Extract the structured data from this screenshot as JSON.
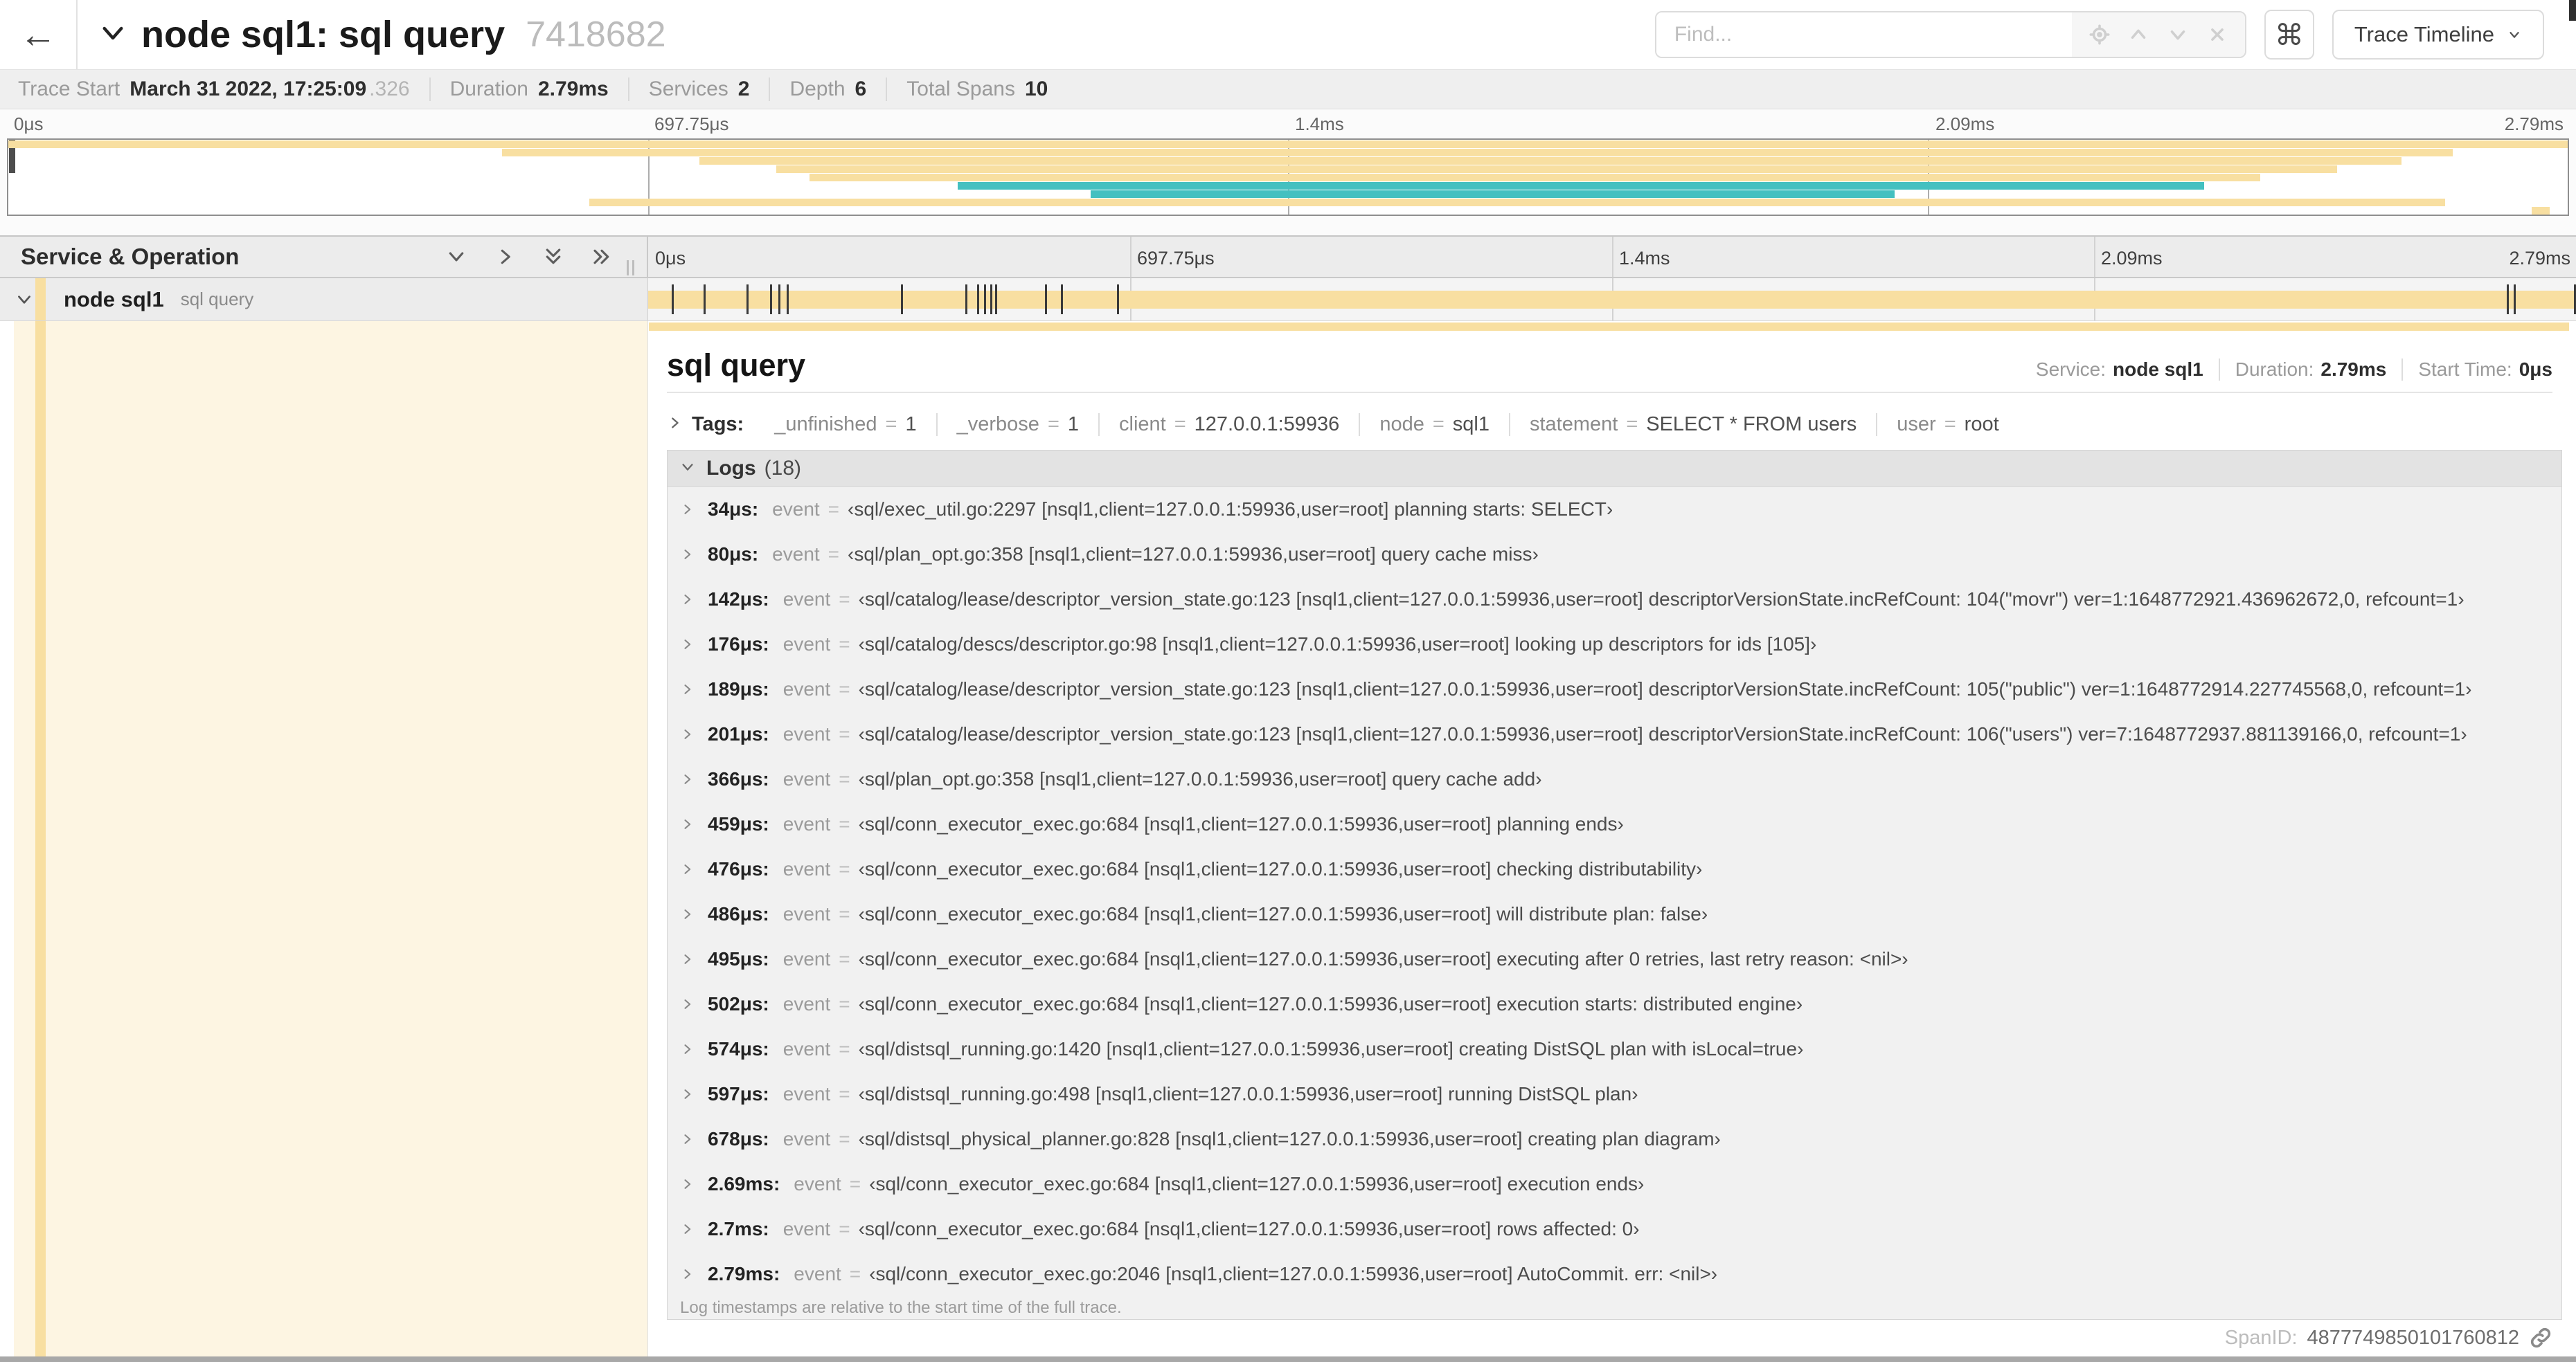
{
  "header": {
    "back_icon": "←",
    "title": "node sql1: sql query",
    "trace_id_short": "7418682",
    "find_placeholder": "Find...",
    "keyboard_shortcut_icon": "⌘",
    "view_selector_label": "Trace Timeline"
  },
  "summary": {
    "items": [
      {
        "label": "Trace Start",
        "value": "March 31 2022, 17:25:09",
        "suffix": ".326"
      },
      {
        "label": "Duration",
        "value": "2.79ms"
      },
      {
        "label": "Services",
        "value": "2"
      },
      {
        "label": "Depth",
        "value": "6"
      },
      {
        "label": "Total Spans",
        "value": "10"
      }
    ]
  },
  "colors": {
    "span_tan": "#F8DFA1",
    "span_teal": "#44C0C0",
    "expanded_row_bg": "#FDF5E2"
  },
  "minimap": {
    "axis_labels": [
      "0μs",
      "697.75μs",
      "1.4ms",
      "2.09ms",
      "2.79ms"
    ],
    "grid_fractions": [
      0.25,
      0.5,
      0.75
    ],
    "spans": [
      {
        "start": 0.0,
        "end": 1.0,
        "color": "#F8DFA1"
      },
      {
        "start": 0.193,
        "end": 0.955,
        "color": "#F8DFA1"
      },
      {
        "start": 0.27,
        "end": 0.935,
        "color": "#F8DFA1"
      },
      {
        "start": 0.3,
        "end": 0.91,
        "color": "#F8DFA1"
      },
      {
        "start": 0.313,
        "end": 0.88,
        "color": "#F8DFA1"
      },
      {
        "start": 0.371,
        "end": 0.858,
        "color": "#44C0C0"
      },
      {
        "start": 0.423,
        "end": 0.737,
        "color": "#44C0C0"
      },
      {
        "start": 0.227,
        "end": 0.952,
        "color": "#F8DFA1"
      },
      {
        "start": 0.986,
        "end": 0.993,
        "color": "#F8DFA1"
      }
    ]
  },
  "timeline": {
    "column_header": "Service & Operation",
    "axis_labels": [
      "0μs",
      "697.75μs",
      "1.4ms",
      "2.09ms",
      "2.79ms"
    ],
    "grid_fractions": [
      0.25,
      0.5,
      0.75
    ],
    "row": {
      "service": "node sql1",
      "operation": "sql query",
      "bar_start": 0.0,
      "bar_end": 1.0,
      "tick_fractions": [
        0.0122,
        0.0287,
        0.0509,
        0.0631,
        0.0677,
        0.072,
        0.1312,
        0.1645,
        0.1706,
        0.1742,
        0.1774,
        0.18,
        0.2057,
        0.214,
        0.243,
        0.9642,
        0.9677,
        0.999
      ]
    }
  },
  "detail": {
    "operation_name": "sql query",
    "meta": [
      {
        "label": "Service:",
        "value": "node sql1"
      },
      {
        "label": "Duration:",
        "value": "2.79ms"
      },
      {
        "label": "Start Time:",
        "value": "0μs"
      }
    ],
    "tags": {
      "label": "Tags:",
      "items": [
        {
          "key": "_unfinished",
          "value": "1"
        },
        {
          "key": "_verbose",
          "value": "1"
        },
        {
          "key": "client",
          "value": "127.0.0.1:59936"
        },
        {
          "key": "node",
          "value": "sql1"
        },
        {
          "key": "statement",
          "value": "SELECT * FROM users"
        },
        {
          "key": "user",
          "value": "root"
        }
      ]
    },
    "logs": {
      "label": "Logs",
      "count": "(18)",
      "entries": [
        {
          "time": "34μs:",
          "key": "event",
          "value": "‹sql/exec_util.go:2297 [nsql1,client=127.0.0.1:59936,user=root] planning starts: SELECT›"
        },
        {
          "time": "80μs:",
          "key": "event",
          "value": "‹sql/plan_opt.go:358 [nsql1,client=127.0.0.1:59936,user=root] query cache miss›"
        },
        {
          "time": "142μs:",
          "key": "event",
          "value": "‹sql/catalog/lease/descriptor_version_state.go:123 [nsql1,client=127.0.0.1:59936,user=root] descriptorVersionState.incRefCount: 104(\"movr\") ver=1:1648772921.436962672,0, refcount=1›"
        },
        {
          "time": "176μs:",
          "key": "event",
          "value": "‹sql/catalog/descs/descriptor.go:98 [nsql1,client=127.0.0.1:59936,user=root] looking up descriptors for ids [105]›"
        },
        {
          "time": "189μs:",
          "key": "event",
          "value": "‹sql/catalog/lease/descriptor_version_state.go:123 [nsql1,client=127.0.0.1:59936,user=root] descriptorVersionState.incRefCount: 105(\"public\") ver=1:1648772914.227745568,0, refcount=1›"
        },
        {
          "time": "201μs:",
          "key": "event",
          "value": "‹sql/catalog/lease/descriptor_version_state.go:123 [nsql1,client=127.0.0.1:59936,user=root] descriptorVersionState.incRefCount: 106(\"users\") ver=7:1648772937.881139166,0, refcount=1›"
        },
        {
          "time": "366μs:",
          "key": "event",
          "value": "‹sql/plan_opt.go:358 [nsql1,client=127.0.0.1:59936,user=root] query cache add›"
        },
        {
          "time": "459μs:",
          "key": "event",
          "value": "‹sql/conn_executor_exec.go:684 [nsql1,client=127.0.0.1:59936,user=root] planning ends›"
        },
        {
          "time": "476μs:",
          "key": "event",
          "value": "‹sql/conn_executor_exec.go:684 [nsql1,client=127.0.0.1:59936,user=root] checking distributability›"
        },
        {
          "time": "486μs:",
          "key": "event",
          "value": "‹sql/conn_executor_exec.go:684 [nsql1,client=127.0.0.1:59936,user=root] will distribute plan: false›"
        },
        {
          "time": "495μs:",
          "key": "event",
          "value": "‹sql/conn_executor_exec.go:684 [nsql1,client=127.0.0.1:59936,user=root] executing after 0 retries, last retry reason: <nil>›"
        },
        {
          "time": "502μs:",
          "key": "event",
          "value": "‹sql/conn_executor_exec.go:684 [nsql1,client=127.0.0.1:59936,user=root] execution starts: distributed engine›"
        },
        {
          "time": "574μs:",
          "key": "event",
          "value": "‹sql/distsql_running.go:1420 [nsql1,client=127.0.0.1:59936,user=root] creating DistSQL plan with isLocal=true›"
        },
        {
          "time": "597μs:",
          "key": "event",
          "value": "‹sql/distsql_running.go:498 [nsql1,client=127.0.0.1:59936,user=root] running DistSQL plan›"
        },
        {
          "time": "678μs:",
          "key": "event",
          "value": "‹sql/distsql_physical_planner.go:828 [nsql1,client=127.0.0.1:59936,user=root] creating plan diagram›"
        },
        {
          "time": "2.69ms:",
          "key": "event",
          "value": "‹sql/conn_executor_exec.go:684 [nsql1,client=127.0.0.1:59936,user=root] execution ends›"
        },
        {
          "time": "2.7ms:",
          "key": "event",
          "value": "‹sql/conn_executor_exec.go:684 [nsql1,client=127.0.0.1:59936,user=root] rows affected: 0›"
        },
        {
          "time": "2.79ms:",
          "key": "event",
          "value": "‹sql/conn_executor_exec.go:2046 [nsql1,client=127.0.0.1:59936,user=root] AutoCommit. err: <nil>›"
        }
      ],
      "footnote": "Log timestamps are relative to the start time of the full trace."
    },
    "span_id": {
      "label": "SpanID:",
      "value": "4877749850101760812"
    }
  }
}
